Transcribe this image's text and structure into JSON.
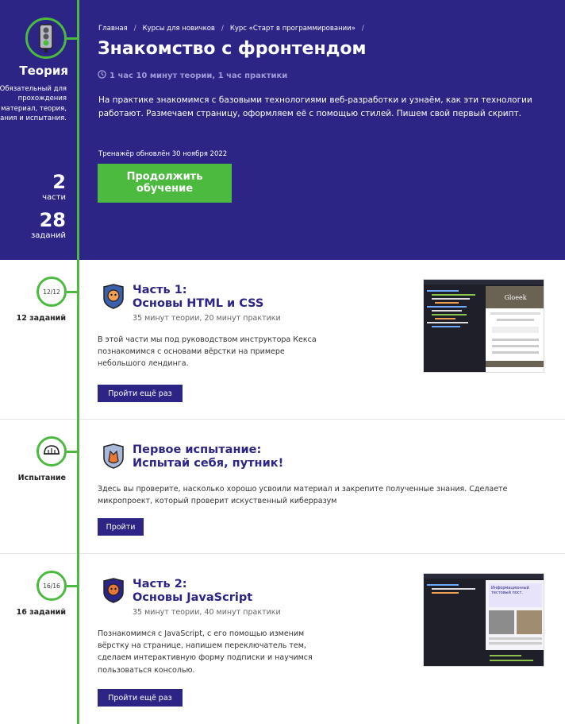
{
  "hero": {
    "breadcrumb": [
      "Главная",
      "Курсы для новичков",
      "Курс «Старт в программировании»"
    ],
    "title": "Знакомство с фронтендом",
    "duration": "1 час 10 минут теории, 1 час практики",
    "description": "На практике знакомимся с базовыми технологиями веб-разработки и узнаём, как эти технологии работают. Размечаем страницу, оформляем её с помощью стилей. Пишем свой первый скрипт.",
    "updated": "Тренажёр обновлён 30 ноября 2022",
    "continue_label": "Продолжить обучение",
    "colors": {
      "background": "#2c2585",
      "accent": "#4cba3f"
    }
  },
  "sidebar": {
    "icon": "traffic-light-icon",
    "title": "Теория",
    "description": "Обязательный для прохождения материал, теория, задания и испытания.",
    "parts_count": "2",
    "parts_label": "части",
    "tasks_count": "28",
    "tasks_label": "заданий"
  },
  "sections": [
    {
      "progress": "12/12",
      "label": "12 заданий",
      "icon": "shield-cat-icon",
      "title": "Часть 1:\nОсновы HTML и CSS",
      "subtitle": "35 минут теории, 20 минут практики",
      "description": "В этой части мы под руководством инструктора Кекса познакомимся с основами вёрстки на примере небольшого лендинга.",
      "button": "Пройти ещё раз",
      "preview_title": "Gloeek"
    },
    {
      "label": "Испытание",
      "icon": "fox-helmet-icon",
      "title": "Первое испытание:\nИспытай себя, путник!",
      "description": "Здесь вы проверите, насколько хорошо усвоили материал и закрепите полученные знания. Сделаете микропроект, который проверит искуственный киберразум",
      "button": "Пройти"
    },
    {
      "progress": "16/16",
      "label": "16 заданий",
      "icon": "shield-cat-icon",
      "title": "Часть 2:\nОсновы JavaScript",
      "subtitle": "35 минут теории, 40 минут практики",
      "description": "Познакомимся с JavaScript, с его помощью изменим вёрстку на странице, напишем переключатель тем, сделаем интерактивную форму подписки и научимся пользоваться консолью.",
      "button": "Пройти ещё раз",
      "preview_title": "Информационный тестовый пост."
    }
  ]
}
